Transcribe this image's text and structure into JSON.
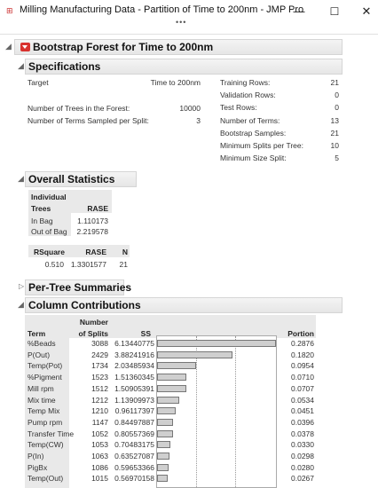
{
  "window": {
    "title": "Milling Manufacturing Data - Partition of Time to 200nm - JMP Pro",
    "minimize": "—",
    "maximize": "☐",
    "close": "✕",
    "more": "•••"
  },
  "report": {
    "title": "Bootstrap Forest for Time to 200nm",
    "specifications": {
      "heading": "Specifications",
      "left": [
        {
          "label": "Target",
          "value": "Time to 200nm"
        },
        {
          "label": "Number of Trees in the Forest:",
          "value": "10000"
        },
        {
          "label": "Number of Terms Sampled per Split:",
          "value": "3"
        }
      ],
      "right": [
        {
          "label": "Training Rows:",
          "value": "21"
        },
        {
          "label": "Validation Rows:",
          "value": "0"
        },
        {
          "label": "Test Rows:",
          "value": "0"
        },
        {
          "label": "Number of Terms:",
          "value": "13"
        },
        {
          "label": "Bootstrap Samples:",
          "value": "21"
        },
        {
          "label": "Minimum Splits per Tree:",
          "value": "10"
        },
        {
          "label": "Minimum Size Split:",
          "value": "5"
        }
      ]
    },
    "overall": {
      "heading": "Overall Statistics",
      "individual_header1": "Individual",
      "individual_header2": "Trees",
      "rase_header": "RASE",
      "rows": [
        {
          "label": "In Bag",
          "value": "1.110173"
        },
        {
          "label": "Out of Bag",
          "value": "2.219578"
        }
      ],
      "rsq_headers": [
        "RSquare",
        "RASE",
        "N"
      ],
      "rsq_values": [
        "0.510",
        "1.3301577",
        "21"
      ]
    },
    "per_tree": {
      "heading": "Per-Tree Summaries"
    },
    "contrib": {
      "heading": "Column Contributions",
      "headers": {
        "term": "Term",
        "num1": "Number",
        "num2": "of Splits",
        "ss": "SS",
        "portion": "Portion"
      },
      "rows": [
        {
          "term": "%Beads",
          "splits": "3088",
          "ss": "6.13440775",
          "portion": "0.2876",
          "frac": 0.2876
        },
        {
          "term": "P(Out)",
          "splits": "2429",
          "ss": "3.88241916",
          "portion": "0.1820",
          "frac": 0.182
        },
        {
          "term": "Temp(Pot)",
          "splits": "1734",
          "ss": "2.03485934",
          "portion": "0.0954",
          "frac": 0.0954
        },
        {
          "term": "%Pigment",
          "splits": "1523",
          "ss": "1.51360345",
          "portion": "0.0710",
          "frac": 0.071
        },
        {
          "term": "Mill rpm",
          "splits": "1512",
          "ss": "1.50905391",
          "portion": "0.0707",
          "frac": 0.0707
        },
        {
          "term": "Mix time",
          "splits": "1212",
          "ss": "1.13909973",
          "portion": "0.0534",
          "frac": 0.0534
        },
        {
          "term": "Temp Mix",
          "splits": "1210",
          "ss": "0.96117397",
          "portion": "0.0451",
          "frac": 0.0451
        },
        {
          "term": "Pump rpm",
          "splits": "1147",
          "ss": "0.84497887",
          "portion": "0.0396",
          "frac": 0.0396
        },
        {
          "term": "Transfer Time",
          "splits": "1052",
          "ss": "0.80557369",
          "portion": "0.0378",
          "frac": 0.0378
        },
        {
          "term": "Temp(CW)",
          "splits": "1053",
          "ss": "0.70483175",
          "portion": "0.0330",
          "frac": 0.033
        },
        {
          "term": "P(In)",
          "splits": "1063",
          "ss": "0.63527087",
          "portion": "0.0298",
          "frac": 0.0298
        },
        {
          "term": "PigBx",
          "splits": "1086",
          "ss": "0.59653366",
          "portion": "0.0280",
          "frac": 0.028
        },
        {
          "term": "Temp(Out)",
          "splits": "1015",
          "ss": "0.56970158",
          "portion": "0.0267",
          "frac": 0.0267
        }
      ]
    }
  }
}
